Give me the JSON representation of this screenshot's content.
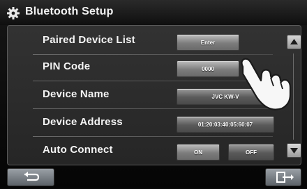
{
  "header": {
    "title": "Bluetooth Setup"
  },
  "rows": [
    {
      "label": "Paired Device List",
      "button": "Enter"
    },
    {
      "label": "PIN Code",
      "value": "0000"
    },
    {
      "label": "Device Name",
      "value": "JVC KW-V"
    },
    {
      "label": "Device Address",
      "value": "01:20:03:40:05:60:07"
    },
    {
      "label": "Auto Connect",
      "on": "ON",
      "off": "OFF"
    }
  ],
  "icons": {
    "settings": "gear-icon",
    "scroll_up": "arrow-up-icon",
    "scroll_down": "arrow-down-icon",
    "back": "return-arrow-icon",
    "exit": "exit-icon",
    "pointer": "pointing-hand-icon"
  }
}
